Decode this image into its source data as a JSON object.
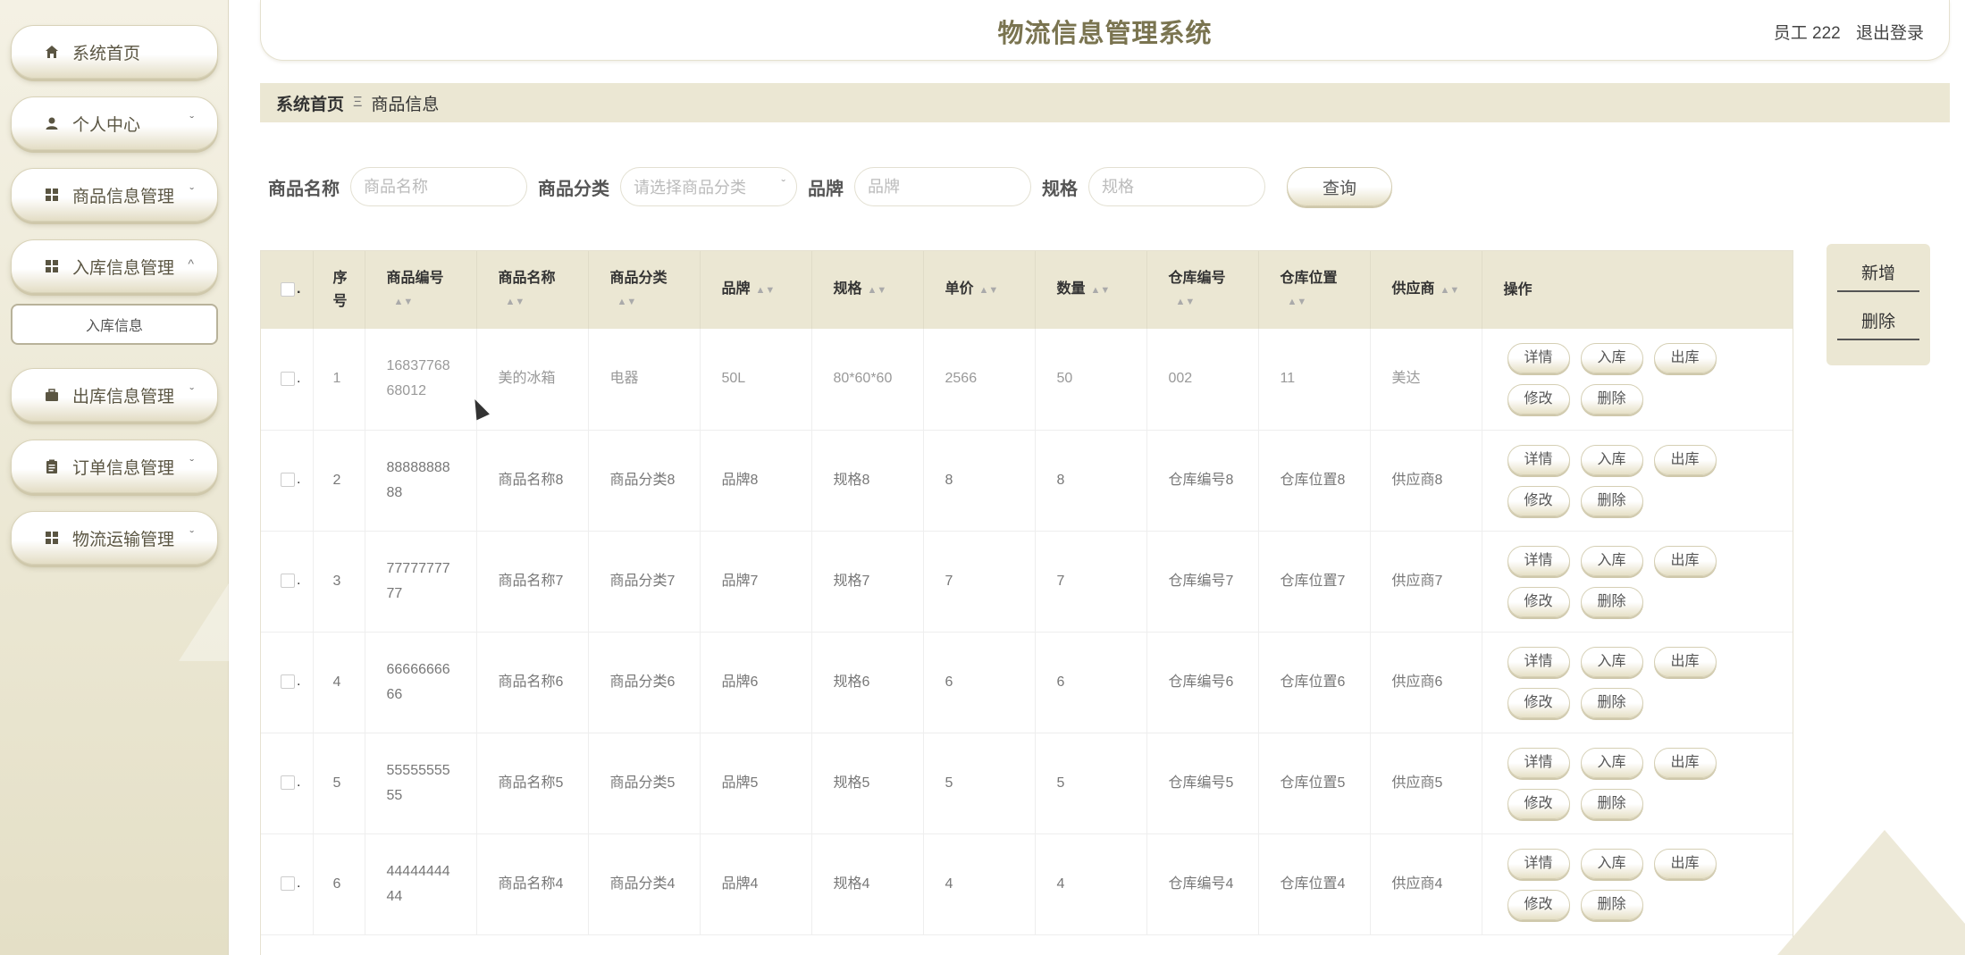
{
  "header": {
    "title": "物流信息管理系统",
    "user_label": "员工 222",
    "logout_label": "退出登录"
  },
  "sidebar": {
    "items": [
      {
        "label": "系统首页",
        "icon": "home-icon",
        "expandable": false
      },
      {
        "label": "个人中心",
        "icon": "user-icon",
        "expandable": true,
        "chevron": "ˇ"
      },
      {
        "label": "商品信息管理",
        "icon": "grid-icon",
        "expandable": true,
        "chevron": "ˇ"
      },
      {
        "label": "入库信息管理",
        "icon": "grid-icon",
        "expandable": true,
        "chevron": "^"
      },
      {
        "label": "出库信息管理",
        "icon": "briefcase-icon",
        "expandable": true,
        "chevron": "ˇ"
      },
      {
        "label": "订单信息管理",
        "icon": "clipboard-icon",
        "expandable": true,
        "chevron": "ˇ"
      },
      {
        "label": "物流运输管理",
        "icon": "grid-icon",
        "expandable": true,
        "chevron": "ˇ"
      }
    ],
    "submenu_label": "入库信息"
  },
  "breadcrumb": {
    "home": "系统首页",
    "separator": "Ξ",
    "current": "商品信息"
  },
  "search": {
    "name_label": "商品名称",
    "name_placeholder": "商品名称",
    "category_label": "商品分类",
    "category_placeholder": "请选择商品分类",
    "brand_label": "品牌",
    "brand_placeholder": "品牌",
    "spec_label": "规格",
    "spec_placeholder": "规格",
    "query_button": "查询"
  },
  "actions": {
    "add": "新增",
    "delete": "删除"
  },
  "table": {
    "headers": {
      "index": "序号",
      "code": "商品编号",
      "name": "商品名称",
      "category": "商品分类",
      "brand": "品牌",
      "spec": "规格",
      "price": "单价",
      "qty": "数量",
      "wh_code": "仓库编号",
      "wh_loc": "仓库位置",
      "supplier": "供应商",
      "ops": "操作"
    },
    "op_labels": {
      "detail": "详情",
      "stock_in": "入库",
      "stock_out": "出库",
      "edit": "修改",
      "remove": "删除"
    },
    "rows": [
      {
        "index": "1",
        "code": "1683776868012",
        "name": "美的冰箱",
        "category": "电器",
        "brand": "50L",
        "spec": "80*60*60",
        "price": "2566",
        "qty": "50",
        "wh_code": "002",
        "wh_loc": "11",
        "supplier": "美达"
      },
      {
        "index": "2",
        "code": "8888888888",
        "name": "商品名称8",
        "category": "商品分类8",
        "brand": "品牌8",
        "spec": "规格8",
        "price": "8",
        "qty": "8",
        "wh_code": "仓库编号8",
        "wh_loc": "仓库位置8",
        "supplier": "供应商8"
      },
      {
        "index": "3",
        "code": "7777777777",
        "name": "商品名称7",
        "category": "商品分类7",
        "brand": "品牌7",
        "spec": "规格7",
        "price": "7",
        "qty": "7",
        "wh_code": "仓库编号7",
        "wh_loc": "仓库位置7",
        "supplier": "供应商7"
      },
      {
        "index": "4",
        "code": "6666666666",
        "name": "商品名称6",
        "category": "商品分类6",
        "brand": "品牌6",
        "spec": "规格6",
        "price": "6",
        "qty": "6",
        "wh_code": "仓库编号6",
        "wh_loc": "仓库位置6",
        "supplier": "供应商6"
      },
      {
        "index": "5",
        "code": "5555555555",
        "name": "商品名称5",
        "category": "商品分类5",
        "brand": "品牌5",
        "spec": "规格5",
        "price": "5",
        "qty": "5",
        "wh_code": "仓库编号5",
        "wh_loc": "仓库位置5",
        "supplier": "供应商5"
      },
      {
        "index": "6",
        "code": "4444444444",
        "name": "商品名称4",
        "category": "商品分类4",
        "brand": "品牌4",
        "spec": "规格4",
        "price": "4",
        "qty": "4",
        "wh_code": "仓库编号4",
        "wh_loc": "仓库位置4",
        "supplier": "供应商4"
      }
    ]
  },
  "colors": {
    "accent": "#7a7450",
    "panel_bg": "#ebe7d3",
    "sidebar_bg": "#f4f1e4"
  }
}
